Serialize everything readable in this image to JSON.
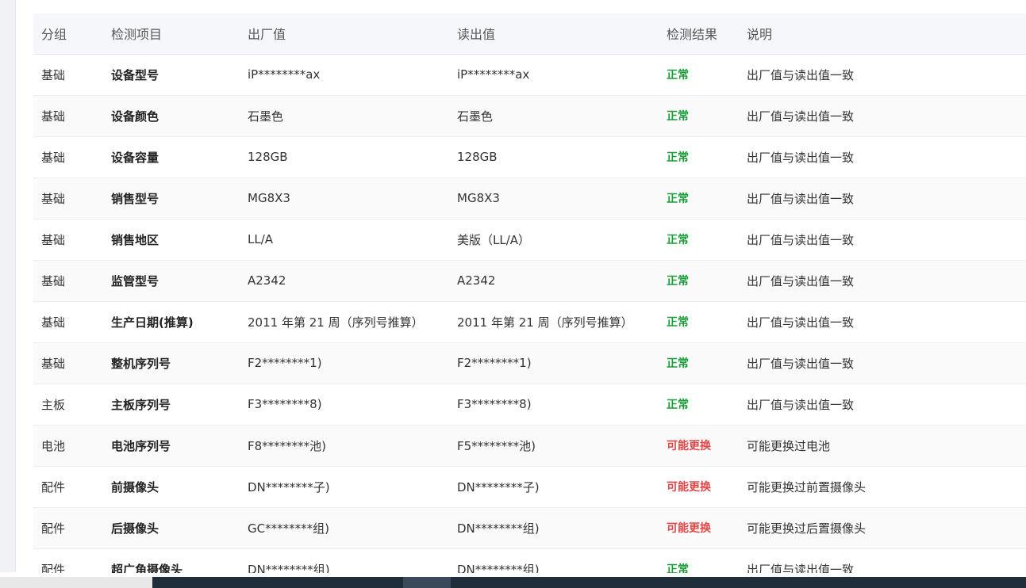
{
  "table": {
    "headers": [
      "分组",
      "检测项目",
      "出厂值",
      "读出值",
      "检测结果",
      "说明"
    ],
    "rows": [
      {
        "group": "基础",
        "item": "设备型号",
        "factory": "iP********ax",
        "read": "iP********ax",
        "result": "正常",
        "status": "ok",
        "note": "出厂值与读出值一致"
      },
      {
        "group": "基础",
        "item": "设备颜色",
        "factory": "石墨色",
        "read": "石墨色",
        "result": "正常",
        "status": "ok",
        "note": "出厂值与读出值一致"
      },
      {
        "group": "基础",
        "item": "设备容量",
        "factory": "128GB",
        "read": "128GB",
        "result": "正常",
        "status": "ok",
        "note": "出厂值与读出值一致"
      },
      {
        "group": "基础",
        "item": "销售型号",
        "factory": "MG8X3",
        "read": "MG8X3",
        "result": "正常",
        "status": "ok",
        "note": "出厂值与读出值一致"
      },
      {
        "group": "基础",
        "item": "销售地区",
        "factory": "LL/A",
        "read": "美版（LL/A）",
        "result": "正常",
        "status": "ok",
        "note": "出厂值与读出值一致"
      },
      {
        "group": "基础",
        "item": "监管型号",
        "factory": "A2342",
        "read": "A2342",
        "result": "正常",
        "status": "ok",
        "note": "出厂值与读出值一致"
      },
      {
        "group": "基础",
        "item": "生产日期(推算)",
        "factory": "2011 年第 21 周（序列号推算）",
        "read": "2011 年第 21 周（序列号推算）",
        "result": "正常",
        "status": "ok",
        "note": "出厂值与读出值一致"
      },
      {
        "group": "基础",
        "item": "整机序列号",
        "factory": "F2********1)",
        "read": "F2********1)",
        "result": "正常",
        "status": "ok",
        "note": "出厂值与读出值一致"
      },
      {
        "group": "主板",
        "item": "主板序列号",
        "factory": "F3********8)",
        "read": "F3********8)",
        "result": "正常",
        "status": "ok",
        "note": "出厂值与读出值一致"
      },
      {
        "group": "电池",
        "item": "电池序列号",
        "factory": "F8********池)",
        "read": "F5********池)",
        "result": "可能更换",
        "status": "warn",
        "note": "可能更换过电池"
      },
      {
        "group": "配件",
        "item": "前摄像头",
        "factory": "DN********子)",
        "read": "DN********子)",
        "result": "可能更换",
        "status": "warn",
        "note": "可能更换过前置摄像头"
      },
      {
        "group": "配件",
        "item": "后摄像头",
        "factory": "GC********组)",
        "read": "DN********组)",
        "result": "可能更换",
        "status": "warn",
        "note": "可能更换过后置摄像头"
      },
      {
        "group": "配件",
        "item": "超广角摄像头",
        "factory": "DN********组)",
        "read": "DN********组)",
        "result": "正常",
        "status": "ok",
        "note": "出厂值与读出值一致"
      }
    ]
  },
  "colors": {
    "ok": "#1a9e3a",
    "warn": "#e04848",
    "header_bg": "#f5f7fa"
  }
}
